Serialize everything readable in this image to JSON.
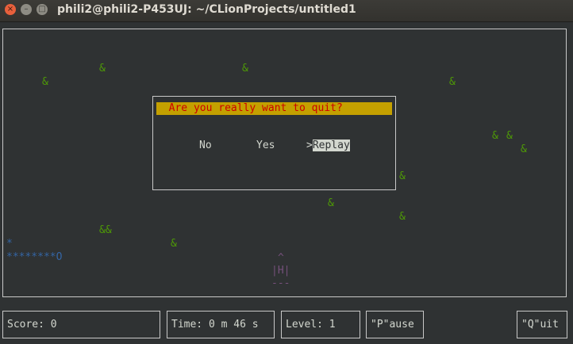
{
  "window": {
    "title": "phili2@phili2-P453UJ: ~/CLionProjects/untitled1",
    "close_glyph": "×",
    "min_glyph": "–",
    "max_glyph": "□"
  },
  "game": {
    "enemy_glyph": "&",
    "enemy_pair_glyph": "&&",
    "snake_head_glyph": "*",
    "snake_body": "********O",
    "ship": {
      "top": "^",
      "middle": "|H|",
      "bottom": "---"
    }
  },
  "dialog": {
    "question": "  Are you really want to quit?",
    "options": [
      {
        "label": "No",
        "selected": false
      },
      {
        "label": "Yes",
        "selected": false
      },
      {
        "label": "Replay",
        "selected": true,
        "cursor": ">"
      }
    ]
  },
  "status": {
    "score": "Score: 0",
    "time": "Time: 0 m 46 s",
    "level": "Level: 1",
    "pause": "\"P\"ause",
    "quit": "\"Q\"uit"
  },
  "colors": {
    "enemy": "#4e9a06",
    "snake": "#3465a4",
    "ship": "#75507b",
    "dialog_header_bg": "#c4a000",
    "dialog_header_text": "#cc0000"
  }
}
